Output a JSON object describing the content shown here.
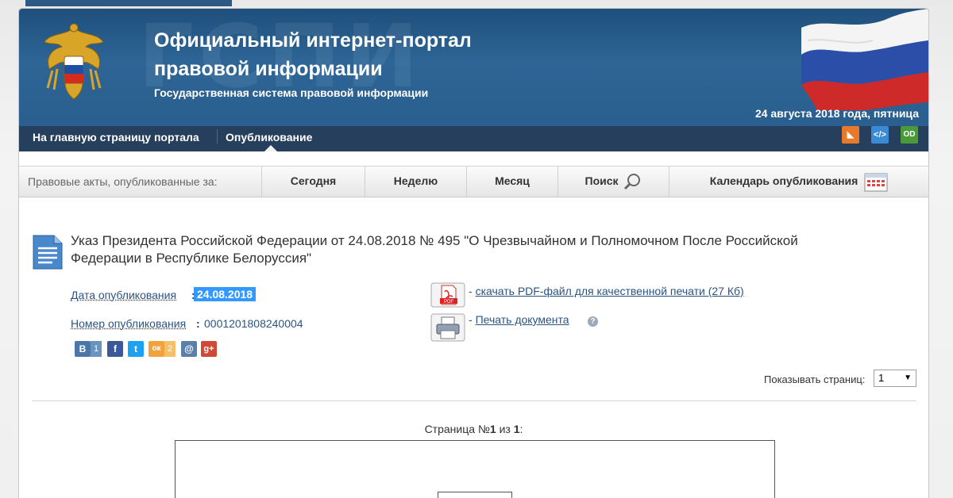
{
  "header": {
    "title_line1": "Официальный интернет-портал",
    "title_line2": "правовой информации",
    "subtitle": "Государственная система правовой информации",
    "watermark": "ГСПИ",
    "date": "24 августа 2018 года, пятница"
  },
  "nav": {
    "items": [
      {
        "label": "На главную страницу портала"
      },
      {
        "label": "Опубликование"
      }
    ],
    "icons": [
      "rss-icon",
      "code-icon",
      "open-data-icon"
    ],
    "icon_glyphs": [
      "◣",
      "</>",
      "OD"
    ]
  },
  "tabs": {
    "label": "Правовые акты, опубликованные за:",
    "items": [
      {
        "label": "Сегодня"
      },
      {
        "label": "Неделю"
      },
      {
        "label": "Месяц"
      },
      {
        "label": "Поиск"
      },
      {
        "label": "Календарь опубликования"
      }
    ]
  },
  "document": {
    "title": "Указ Президента Российской Федерации от 24.08.2018 № 495 \"О Чрезвычайном и Полномочном После Российской Федерации в Республике Белоруссия\"",
    "pub_date_label": "Дата опубликования",
    "pub_date_value": "24.08.2018",
    "pub_number_label": "Номер опубликования",
    "pub_number_value": "0001201808240004",
    "pdf_prefix": "- ",
    "pdf_link": "скачать PDF-файл для качественной печати (27 Кб)",
    "print_prefix": "- ",
    "print_link": "Печать документа",
    "pdf_icon_label": "PDF"
  },
  "social": {
    "vk_count": "1",
    "ok_count": "2",
    "glyphs": [
      "В",
      "f",
      "t",
      "ок",
      "@",
      "g+"
    ]
  },
  "paging": {
    "label": "Показывать страниц:",
    "selected": "1",
    "caret": "▼",
    "page_prefix": "Страница №",
    "page_current": "1",
    "page_mid": " из ",
    "page_total": "1",
    "page_suffix": ":"
  },
  "colors": {
    "header_blue": "#2d6596",
    "nav_dark": "#263f5c",
    "link_blue": "#2a5482",
    "highlight": "#3399ff"
  }
}
